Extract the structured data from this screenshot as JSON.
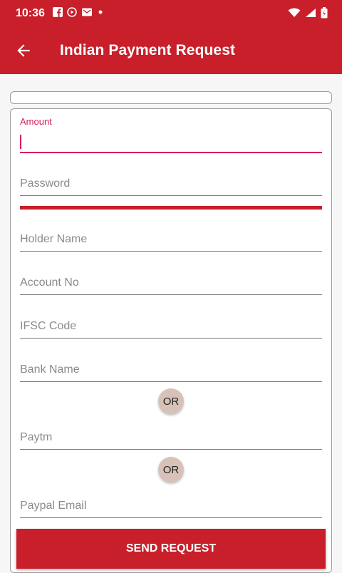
{
  "status_bar": {
    "time": "10:36",
    "left_icons": [
      "facebook-icon",
      "media-icon",
      "mail-icon",
      "dot-icon"
    ],
    "right_icons": [
      "wifi-icon",
      "signal-icon",
      "battery-icon"
    ]
  },
  "app_bar": {
    "title": "Indian Payment Request",
    "back_icon": "arrow-back-icon"
  },
  "form": {
    "amount_label": "Amount",
    "amount_value": "",
    "password_placeholder": "Password",
    "holder_name_placeholder": "Holder Name",
    "account_no_placeholder": "Account No",
    "ifsc_placeholder": "IFSC Code",
    "bank_name_placeholder": "Bank Name",
    "or_1": "OR",
    "paytm_placeholder": "Paytm",
    "or_2": "OR",
    "paypal_placeholder": "Paypal Email",
    "send_label": "SEND REQUEST"
  },
  "colors": {
    "primary": "#c81f2a",
    "accent": "#d81b60",
    "or_badge": "#d8c2b8"
  }
}
